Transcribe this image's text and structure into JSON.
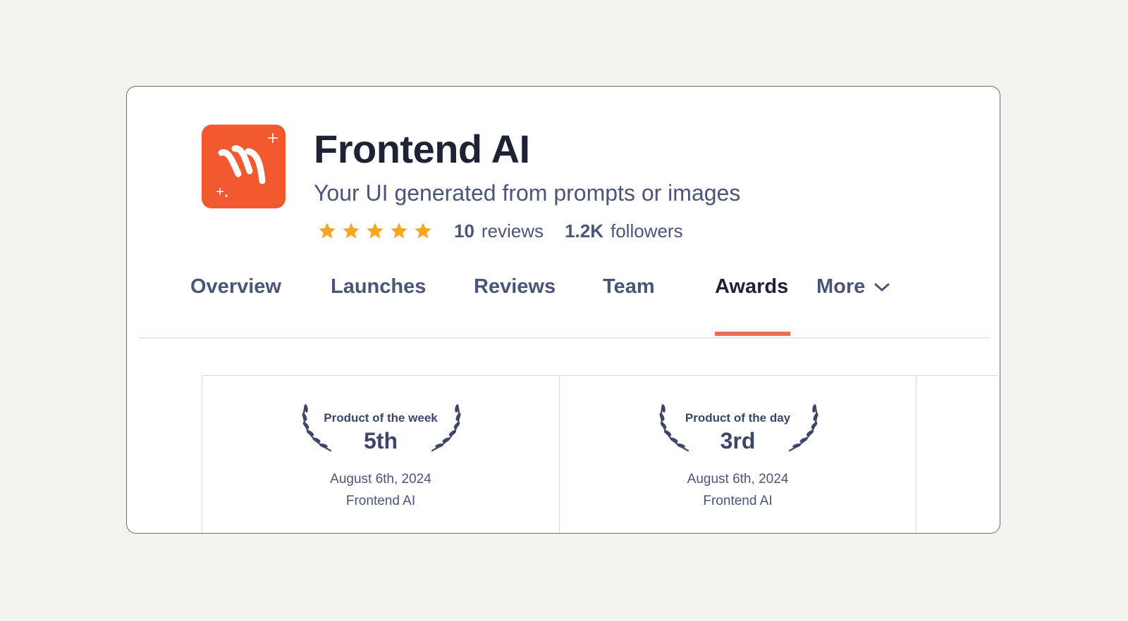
{
  "product": {
    "name": "Frontend AI",
    "tagline": "Your UI generated from prompts or images",
    "rating_stars": 5,
    "reviews_count": "10",
    "reviews_label": "reviews",
    "followers_count": "1.2K",
    "followers_label": "followers",
    "brand_color": "#f2592e",
    "star_color": "#f5a623"
  },
  "tabs": [
    {
      "label": "Overview",
      "active": false
    },
    {
      "label": "Launches",
      "active": false
    },
    {
      "label": "Reviews",
      "active": false
    },
    {
      "label": "Team",
      "active": false
    },
    {
      "label": "Awards",
      "active": true
    },
    {
      "label": "More",
      "active": false,
      "icon": "chevron-down-icon"
    }
  ],
  "awards": [
    {
      "label": "Product of the week",
      "rank": "5th",
      "date": "August 6th, 2024",
      "product": "Frontend AI",
      "icon": "laurel-wreath-icon"
    },
    {
      "label": "Product of the day",
      "rank": "3rd",
      "date": "August 6th, 2024",
      "product": "Frontend AI",
      "icon": "laurel-wreath-icon"
    }
  ],
  "accent_color": "#ee6a56"
}
